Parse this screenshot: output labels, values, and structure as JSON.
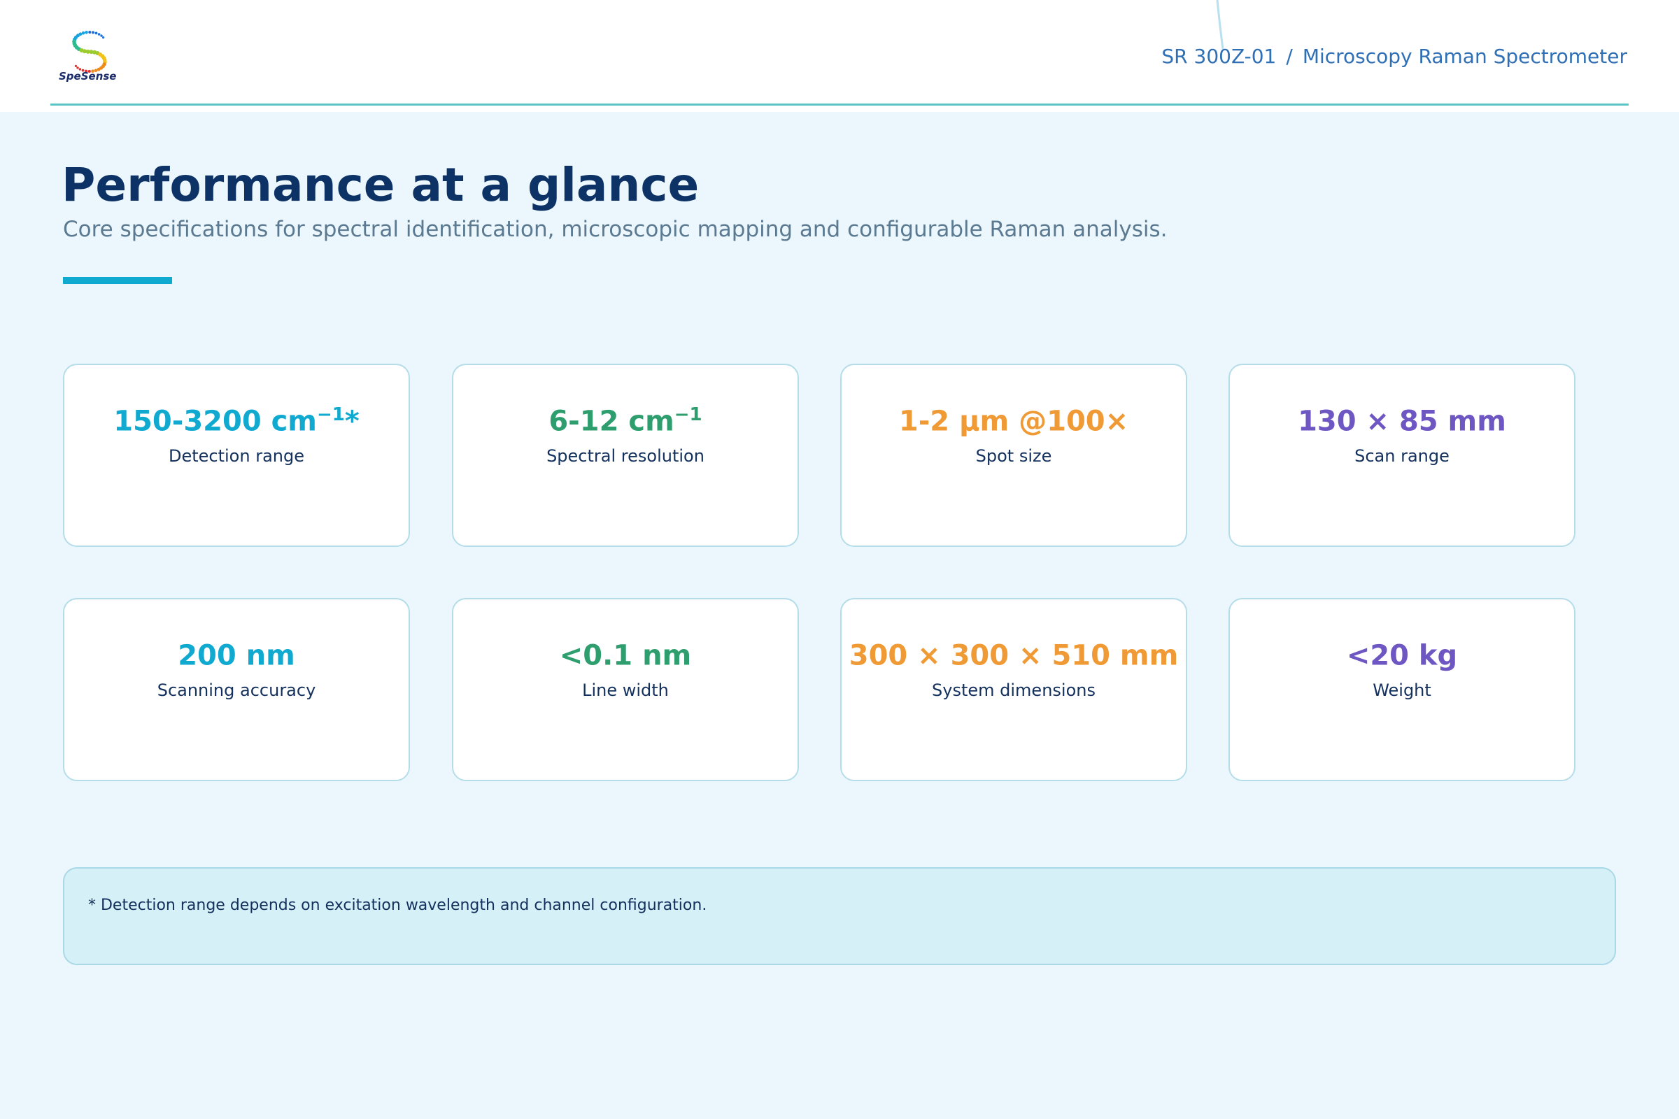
{
  "header": {
    "logo_text": "SpeSense",
    "model": "SR 300Z-01",
    "separator": "/",
    "product": "Microscopy Raman Spectrometer"
  },
  "page": {
    "title": "Performance at a glance",
    "subtitle": "Core specifications for spectral identification, microscopic mapping and configurable Raman analysis."
  },
  "specs": [
    {
      "value": "150-3200 cm",
      "sup": "−1",
      "suffix": "*",
      "label": "Detection range",
      "color": "#10a9cf"
    },
    {
      "value": "6-12 cm",
      "sup": "−1",
      "suffix": "",
      "label": "Spectral resolution",
      "color": "#2e9e6e"
    },
    {
      "value": "1-2 µm @100×",
      "sup": "",
      "suffix": "",
      "label": "Spot size",
      "color": "#ef9a35"
    },
    {
      "value": "130 × 85 mm",
      "sup": "",
      "suffix": "",
      "label": "Scan range",
      "color": "#6e57c2"
    },
    {
      "value": "200 nm",
      "sup": "",
      "suffix": "",
      "label": "Scanning accuracy",
      "color": "#10a9cf"
    },
    {
      "value": "<0.1 nm",
      "sup": "",
      "suffix": "",
      "label": "Line width",
      "color": "#2e9e6e"
    },
    {
      "value": "300 × 300 × 510 mm",
      "sup": "",
      "suffix": "",
      "label": "System dimensions",
      "color": "#ef9a35"
    },
    {
      "value": "<20 kg",
      "sup": "",
      "suffix": "",
      "label": "Weight",
      "color": "#6e57c2"
    }
  ],
  "footnote": "* Detection range depends on excitation wavelength and channel configuration.",
  "colors": {
    "background": "#ebf7fc",
    "title": "#0d3266",
    "accent": "#10a9cf",
    "rule": "#5cc4c4"
  }
}
